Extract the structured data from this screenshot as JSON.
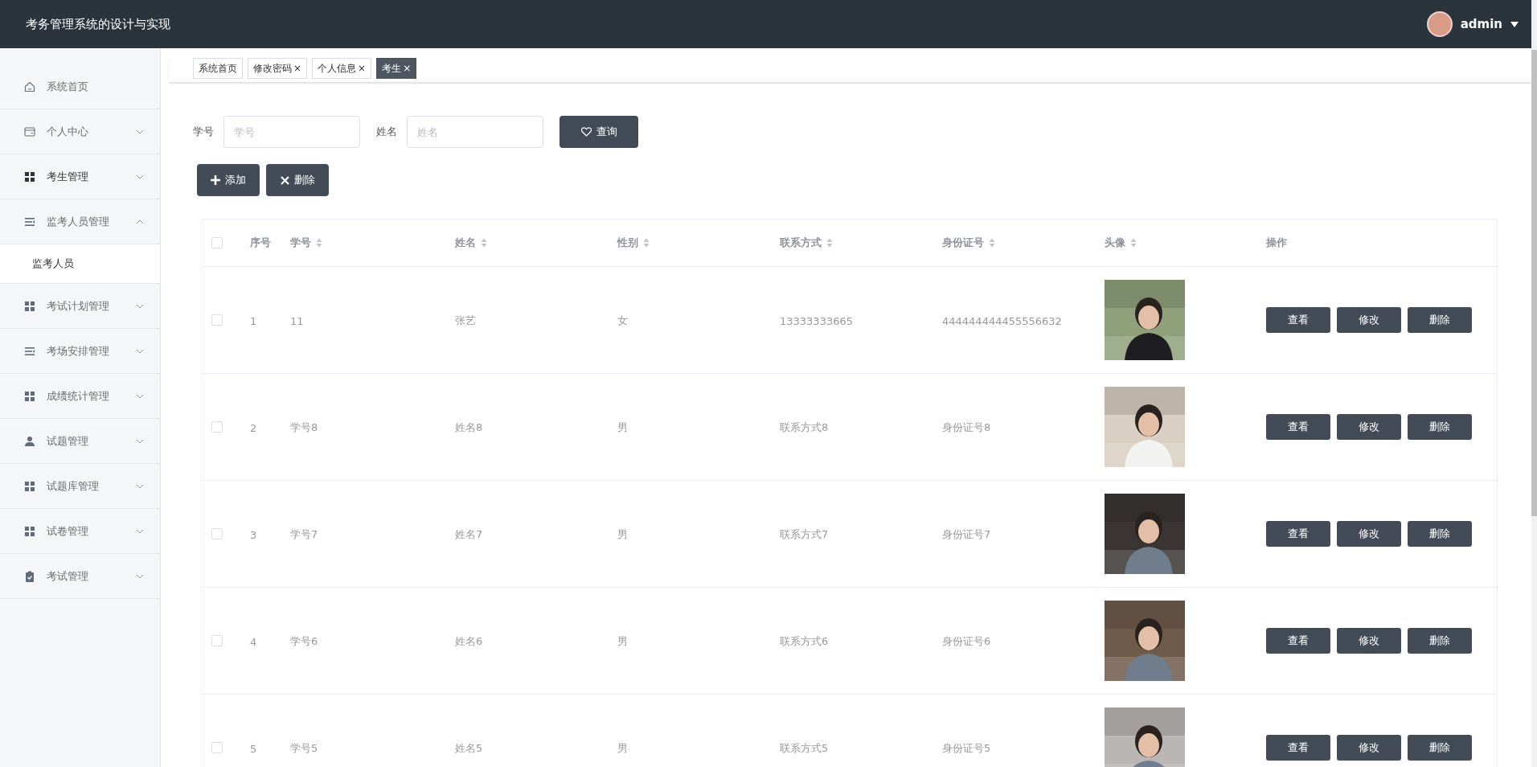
{
  "header": {
    "title": "考务管理系统的设计与实现",
    "user": "admin"
  },
  "sidebar": {
    "items": [
      {
        "label": "系统首页",
        "kind": "home",
        "selected": false
      },
      {
        "label": "个人中心",
        "kind": "card",
        "selected": false,
        "expanded": false
      },
      {
        "label": "考生管理",
        "kind": "grid",
        "selected": true,
        "expanded": false
      },
      {
        "label": "监考人员管理",
        "kind": "list",
        "selected": false,
        "expanded": true,
        "children": [
          {
            "label": "监考人员"
          }
        ]
      },
      {
        "label": "考试计划管理",
        "kind": "grid",
        "selected": false,
        "expanded": false
      },
      {
        "label": "考场安排管理",
        "kind": "list",
        "selected": false,
        "expanded": false
      },
      {
        "label": "成绩统计管理",
        "kind": "grid",
        "selected": false,
        "expanded": false
      },
      {
        "label": "试题管理",
        "kind": "person",
        "selected": false,
        "expanded": false
      },
      {
        "label": "试题库管理",
        "kind": "grid",
        "selected": false,
        "expanded": false
      },
      {
        "label": "试卷管理",
        "kind": "grid",
        "selected": false,
        "expanded": false
      },
      {
        "label": "考试管理",
        "kind": "clipboard",
        "selected": false,
        "expanded": false
      }
    ]
  },
  "tabs": [
    {
      "label": "系统首页",
      "selected": false
    },
    {
      "label": "修改密码",
      "close": "×",
      "selected": false
    },
    {
      "label": "个人信息",
      "close": "×",
      "selected": false
    },
    {
      "label": "考生",
      "close": "×",
      "selected": true
    }
  ],
  "search": {
    "fields": [
      {
        "label": "学号",
        "placeholder": "学号"
      },
      {
        "label": "姓名",
        "placeholder": "姓名"
      }
    ],
    "button": "查询"
  },
  "actions": [
    {
      "label": "添加",
      "kind": "add"
    },
    {
      "label": "删除",
      "kind": "delete"
    }
  ],
  "table": {
    "header_checkbox": {
      "checked": false
    },
    "columns": [
      {
        "label": "序号",
        "sortable": false
      },
      {
        "label": "学号",
        "sortable": true
      },
      {
        "label": "姓名",
        "sortable": true
      },
      {
        "label": "性别",
        "sortable": true
      },
      {
        "label": "联系方式",
        "sortable": true
      },
      {
        "label": "身份证号",
        "sortable": true
      },
      {
        "label": "头像",
        "sortable": true
      },
      {
        "label": "操作",
        "sortable": false
      }
    ],
    "rows": [
      {
        "checked": false,
        "cells": [
          "1",
          "11",
          "张艺",
          "女",
          "13333333665",
          "444444444455556632"
        ],
        "avatar": {
          "kind": "picture"
        },
        "buttons": [
          "查看",
          "修改",
          "删除"
        ]
      },
      {
        "checked": false,
        "cells": [
          "2",
          "学号8",
          "姓名8",
          "男",
          "联系方式8",
          "身份证号8"
        ],
        "avatar": {
          "kind": "picture"
        },
        "buttons": [
          "查看",
          "修改",
          "删除"
        ]
      },
      {
        "checked": false,
        "cells": [
          "3",
          "学号7",
          "姓名7",
          "男",
          "联系方式7",
          "身份证号7"
        ],
        "avatar": {
          "kind": "picture"
        },
        "buttons": [
          "查看",
          "修改",
          "删除"
        ]
      },
      {
        "checked": false,
        "cells": [
          "4",
          "学号6",
          "姓名6",
          "男",
          "联系方式6",
          "身份证号6"
        ],
        "avatar": {
          "kind": "picture"
        },
        "buttons": [
          "查看",
          "修改",
          "删除"
        ]
      },
      {
        "checked": false,
        "cells": [
          "5",
          "学号5",
          "姓名5",
          "男",
          "联系方式5",
          "身份证号5"
        ],
        "avatar": {
          "kind": "picture"
        },
        "buttons": [
          "查看",
          "修改",
          "删除"
        ]
      }
    ]
  }
}
